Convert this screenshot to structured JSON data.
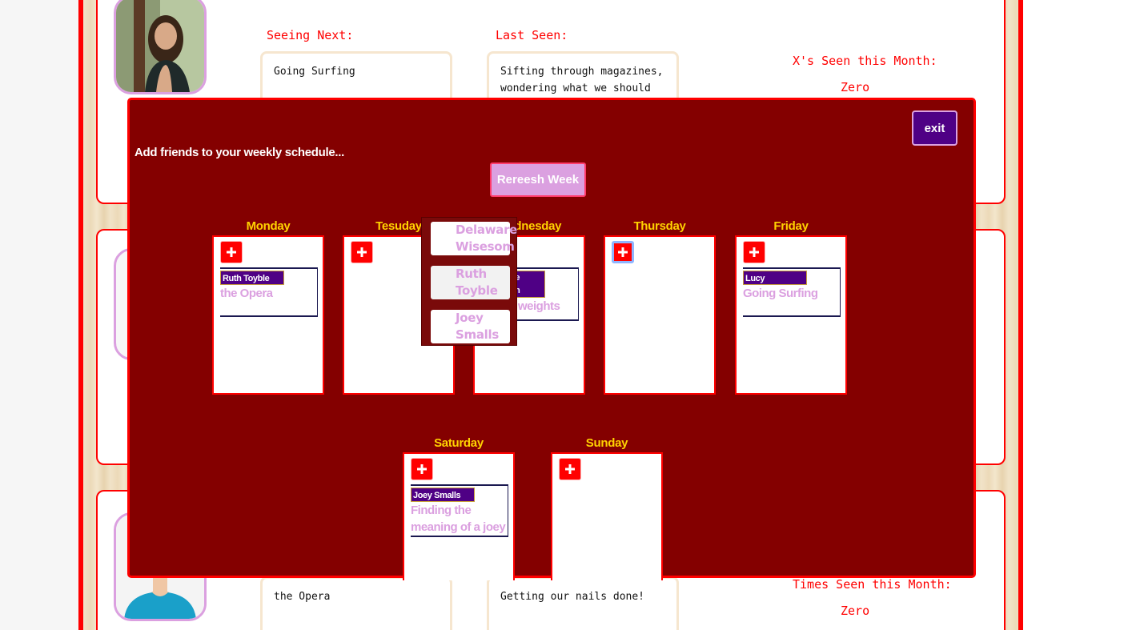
{
  "background": {
    "card1": {
      "seeing_next_label": "Seeing Next:",
      "seeing_next_value": "Going Surfing",
      "last_seen_label": "Last Seen:",
      "last_seen_value": "Sifting through magazines, wondering what we should",
      "seen_month_label": "X's Seen this Month:",
      "seen_month_value": "Zero"
    },
    "card3": {
      "seeing_next_value": "the Opera",
      "last_seen_value": "Getting our nails done!",
      "seen_month_label": "Times Seen this Month:",
      "seen_month_value": "Zero"
    }
  },
  "modal": {
    "title": "Add friends to your weekly schedule...",
    "exit_label": "exit",
    "refresh_label": "Rereesh Week",
    "days": [
      {
        "label": "Monday",
        "entry": {
          "name": "Ruth Toyble",
          "activity": "the Opera"
        }
      },
      {
        "label": "Tesuday"
      },
      {
        "label": "Wednesday",
        "entry": {
          "name": "Delaware Wisesom",
          "activity": "Lifting weights"
        }
      },
      {
        "label": "Thursday"
      },
      {
        "label": "Friday",
        "entry": {
          "name": "Lucy",
          "activity": "Going Surfing"
        }
      },
      {
        "label": "Saturday",
        "entry": {
          "name": "Joey Smalls",
          "activity": "Finding the meaning of a joey"
        }
      },
      {
        "label": "Sunday"
      }
    ],
    "dropdown": [
      "Delaware Wisesom",
      "Ruth Toyble",
      "Joey Smalls"
    ]
  },
  "colors": {
    "modal_bg": "#840000",
    "accent_red": "#ff0000",
    "day_label": "#ffd200",
    "name_tag": "#4f0085",
    "activity_text": "#dba0e0"
  }
}
